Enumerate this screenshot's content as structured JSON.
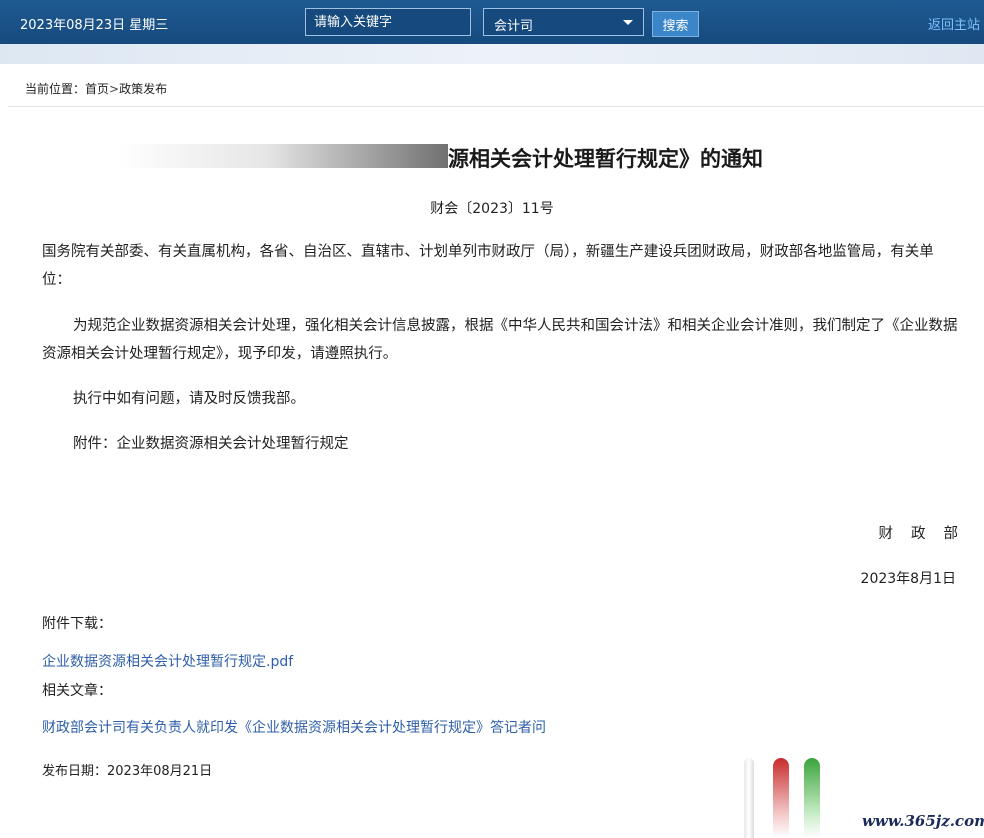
{
  "header": {
    "date": "2023年08月23日  星期三",
    "search_placeholder": "请输入关键字",
    "select_value": "会计司",
    "search_button": "搜索",
    "home_link": "返回主站"
  },
  "breadcrumb": {
    "prefix": "当前位置：",
    "home": "首页",
    "separator": ">",
    "current": "政策发布"
  },
  "article": {
    "title_visible": "源相关会计处理暂行规定》的通知",
    "doc_number": "财会〔2023〕11号",
    "addressee": "国务院有关部委、有关直属机构，各省、自治区、直辖市、计划单列市财政厅（局），新疆生产建设兵团财政局，财政部各地监管局，有关单位：",
    "body": "为规范企业数据资源相关会计处理，强化相关会计信息披露，根据《中华人民共和国会计法》和相关企业会计准则，我们制定了《企业数据资源相关会计处理暂行规定》，现予印发，请遵照执行。",
    "feedback": "执行中如有问题，请及时反馈我部。",
    "attachment": "附件：企业数据资源相关会计处理暂行规定",
    "signature_org": "财政部",
    "signature_date": "2023年8月1日"
  },
  "downloads": {
    "label": "附件下载：",
    "file": "企业数据资源相关会计处理暂行规定.pdf"
  },
  "related": {
    "label": "相关文章：",
    "article": "财政部会计司有关负责人就印发《企业数据资源相关会计处理暂行规定》答记者问"
  },
  "publish_date": "发布日期：2023年08月21日",
  "watermark": "www.365jz.com",
  "colors": {
    "header_bg": "#164a7e",
    "link": "#2f5fa8",
    "home_link": "#7fc0ff"
  }
}
